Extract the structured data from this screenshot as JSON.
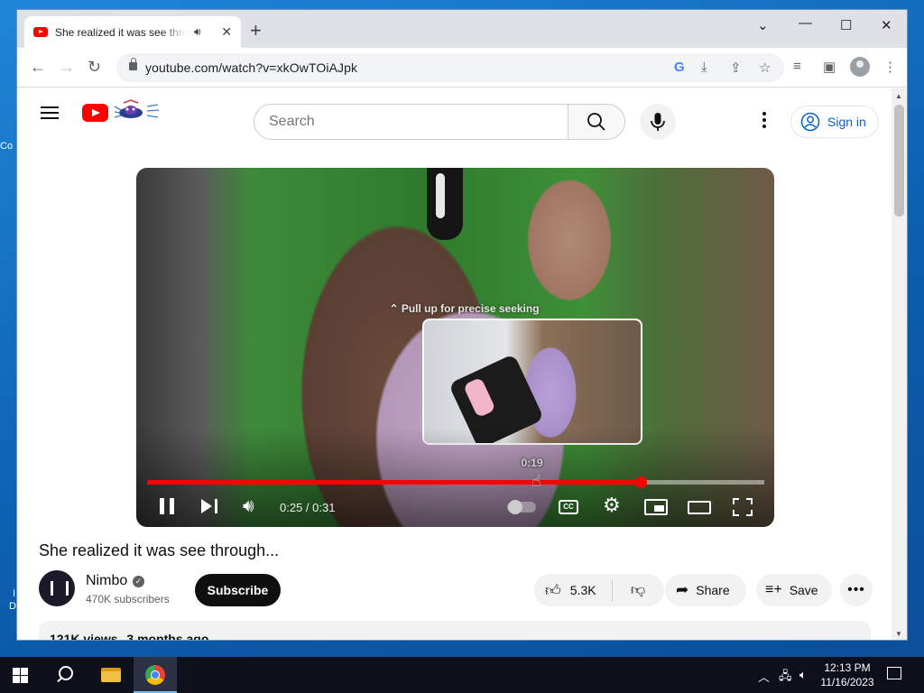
{
  "desktop": {
    "edge_labels": [
      "Co",
      "I",
      "D"
    ]
  },
  "browser": {
    "tab_title": "She realized it was see through...",
    "tab_title_visible": "She realized it was see throu",
    "new_tab_symbol": "+",
    "url": "youtube.com/watch?v=xkOwTOiAJpk",
    "window_controls": {
      "dropdown": "⌄",
      "minimize": "—",
      "maximize": "☐",
      "close": "✕"
    }
  },
  "youtube": {
    "search_placeholder": "Search",
    "signin_label": "Sign in",
    "accent_color": "#ff0000",
    "link_color": "#065fd4"
  },
  "player": {
    "seek_hint": "⌃ Pull up for precise seeking",
    "preview_time": "0:19",
    "time_display": "0:25 / 0:31",
    "progress_fraction": 0.8,
    "hover_fraction": 0.62,
    "cc_label": "CC"
  },
  "video": {
    "title": "She realized it was see through...",
    "channel": "Nimbo",
    "subscribers": "470K subscribers",
    "subscribe_label": "Subscribe",
    "likes": "5.3K",
    "share_label": "Share",
    "save_label": "Save",
    "views": "121K views",
    "age": "3 months ago"
  },
  "taskbar": {
    "time": "12:13 PM",
    "date": "11/16/2023"
  }
}
